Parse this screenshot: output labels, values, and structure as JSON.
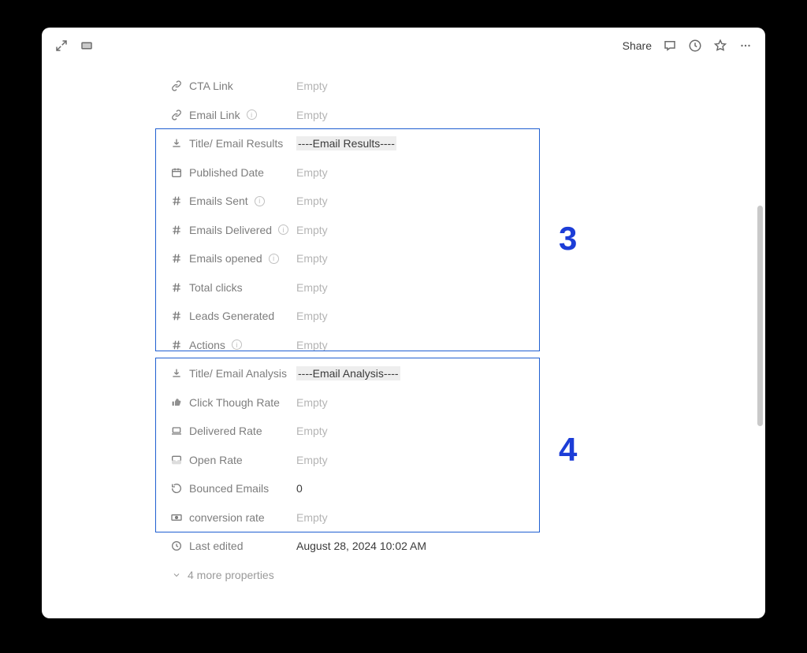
{
  "titlebar": {
    "share": "Share"
  },
  "rows": [
    {
      "icon": "link",
      "label": "CTA Link",
      "info": false,
      "value": "Empty",
      "empty": true,
      "hl": false
    },
    {
      "icon": "link",
      "label": "Email Link",
      "info": true,
      "value": "Empty",
      "empty": true,
      "hl": false
    },
    {
      "icon": "download",
      "label": "Title/ Email Results",
      "info": false,
      "value": "----Email Results----",
      "empty": false,
      "hl": true
    },
    {
      "icon": "calendar",
      "label": "Published Date",
      "info": false,
      "value": "Empty",
      "empty": true,
      "hl": false
    },
    {
      "icon": "hash",
      "label": "Emails Sent",
      "info": true,
      "value": "Empty",
      "empty": true,
      "hl": false
    },
    {
      "icon": "hash",
      "label": "Emails Delivered",
      "info": true,
      "value": "Empty",
      "empty": true,
      "hl": false
    },
    {
      "icon": "hash",
      "label": "Emails opened",
      "info": true,
      "value": "Empty",
      "empty": true,
      "hl": false
    },
    {
      "icon": "hash",
      "label": "Total clicks",
      "info": false,
      "value": "Empty",
      "empty": true,
      "hl": false
    },
    {
      "icon": "hash",
      "label": "Leads Generated",
      "info": false,
      "value": "Empty",
      "empty": true,
      "hl": false
    },
    {
      "icon": "hash",
      "label": "Actions",
      "info": true,
      "value": "Empty",
      "empty": true,
      "hl": false
    },
    {
      "icon": "download",
      "label": "Title/ Email Analysis",
      "info": false,
      "value": "----Email Analysis----",
      "empty": false,
      "hl": true
    },
    {
      "icon": "thumb",
      "label": "Click Though Rate",
      "info": false,
      "value": "Empty",
      "empty": true,
      "hl": false
    },
    {
      "icon": "laptop",
      "label": "Delivered Rate",
      "info": false,
      "value": "Empty",
      "empty": true,
      "hl": false
    },
    {
      "icon": "inbox",
      "label": "Open Rate",
      "info": false,
      "value": "Empty",
      "empty": true,
      "hl": false
    },
    {
      "icon": "rotate",
      "label": "Bounced Emails",
      "info": false,
      "value": "0",
      "empty": false,
      "hl": false
    },
    {
      "icon": "money",
      "label": "conversion rate",
      "info": false,
      "value": "Empty",
      "empty": true,
      "hl": false
    },
    {
      "icon": "clock",
      "label": "Last edited",
      "info": false,
      "value": "August 28, 2024 10:02 AM",
      "empty": false,
      "hl": false
    }
  ],
  "more_props": "4 more properties",
  "annotations": {
    "label3": "3",
    "label4": "4"
  }
}
